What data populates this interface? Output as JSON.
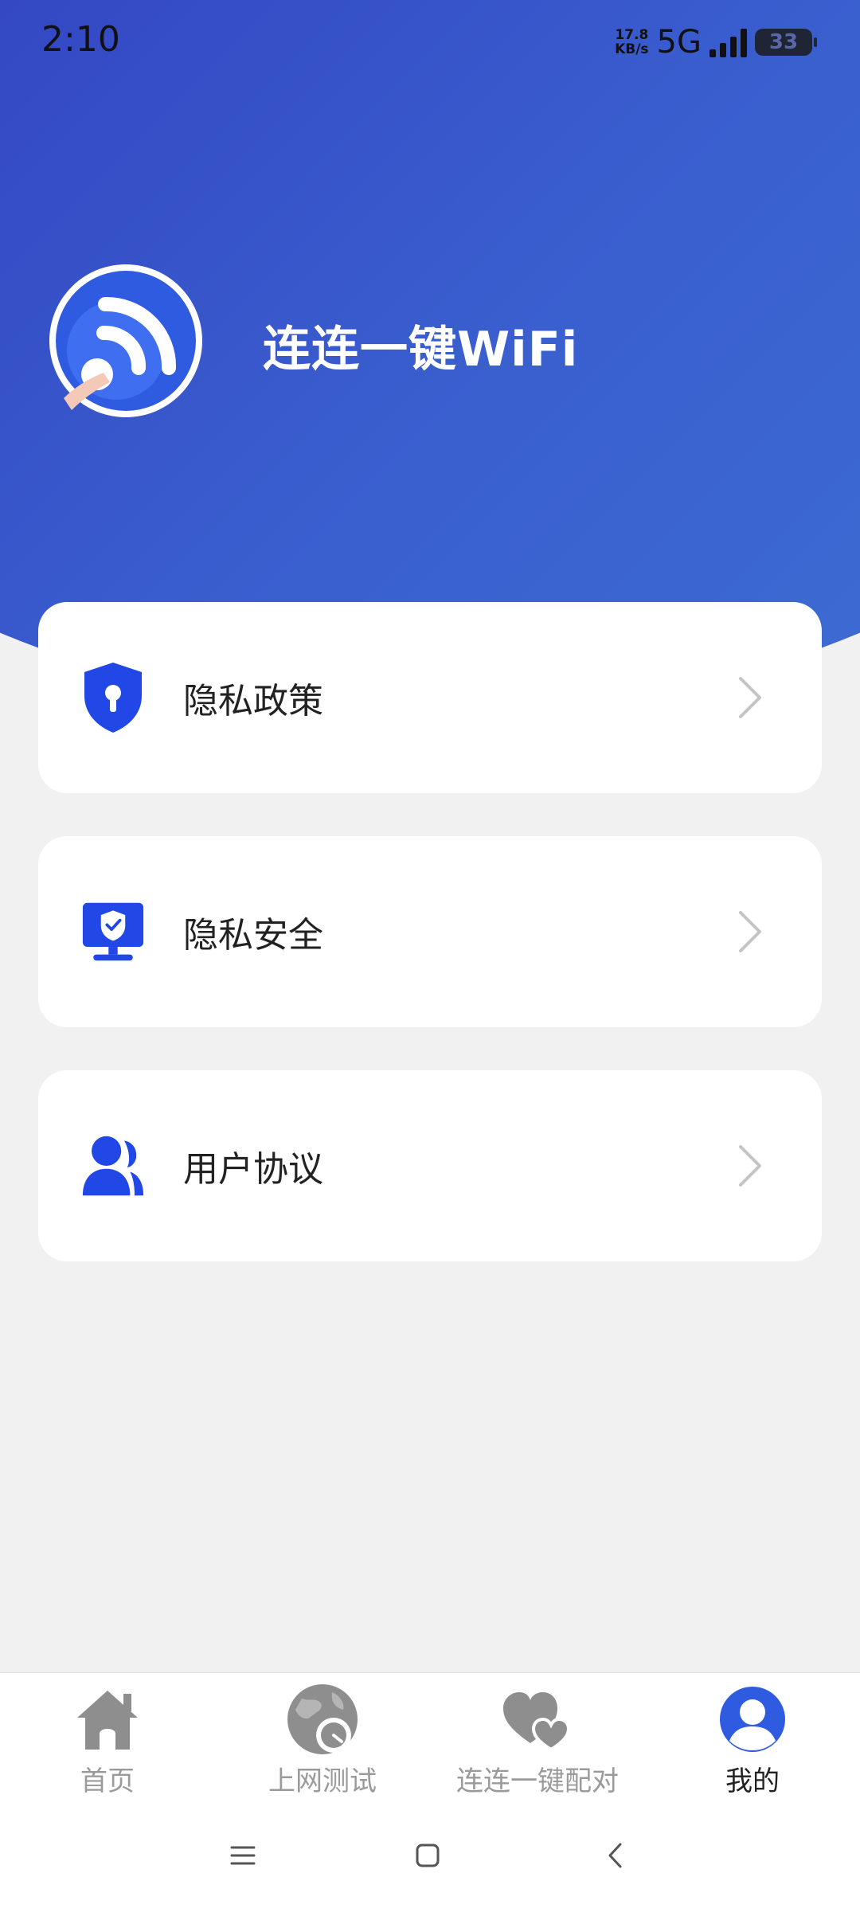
{
  "status_bar": {
    "time": "2:10",
    "net_speed_value": "17.8",
    "net_speed_unit": "KB/s",
    "network_type": "5G",
    "battery_level": "33"
  },
  "header": {
    "app_title": "连连一键WiFi",
    "logo_icon": "wifi-logo-icon"
  },
  "menu": {
    "items": [
      {
        "label": "隐私政策",
        "icon": "shield-lock-icon"
      },
      {
        "label": "隐私安全",
        "icon": "monitor-shield-icon"
      },
      {
        "label": "用户协议",
        "icon": "users-icon"
      }
    ]
  },
  "tabbar": {
    "tabs": [
      {
        "label": "首页",
        "icon": "home-icon",
        "active": false
      },
      {
        "label": "上网测试",
        "icon": "globe-speed-icon",
        "active": false
      },
      {
        "label": "连连一键配对",
        "icon": "hearts-icon",
        "active": false
      },
      {
        "label": "我的",
        "icon": "user-avatar-icon",
        "active": true
      }
    ]
  },
  "colors": {
    "brand_blue": "#2f5be0",
    "hero_gradient_start": "#3448c4",
    "hero_gradient_end": "#3c6bd3",
    "background": "#f1f1f1",
    "tab_inactive": "#9a9a9a",
    "tab_icon_inactive": "#8e8e8e"
  }
}
